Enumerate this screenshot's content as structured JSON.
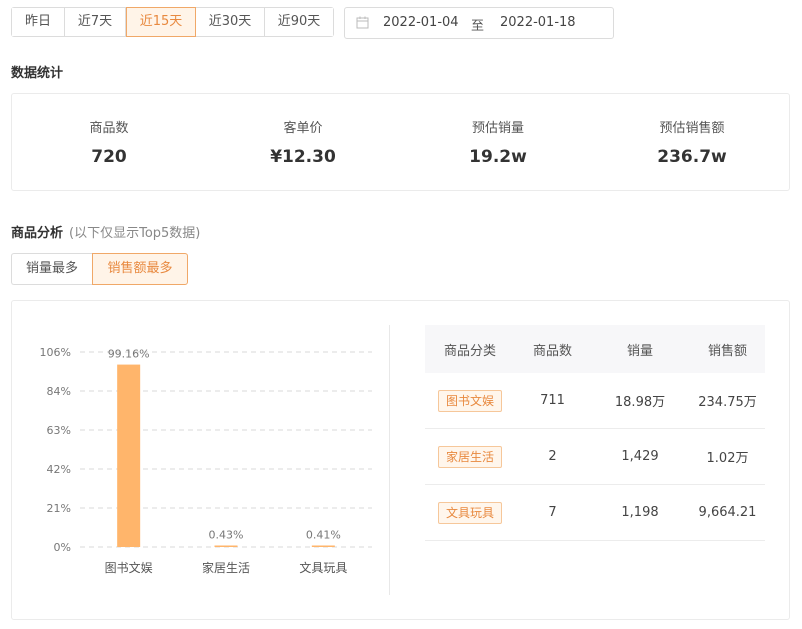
{
  "date_range": {
    "options": [
      {
        "label": "昨日",
        "active": false
      },
      {
        "label": "近7天",
        "active": false
      },
      {
        "label": "近15天",
        "active": true
      },
      {
        "label": "近30天",
        "active": false
      },
      {
        "label": "近90天",
        "active": false
      }
    ],
    "start": "2022-01-04",
    "separator": "至",
    "end": "2022-01-18"
  },
  "stats": {
    "title": "数据统计",
    "items": [
      {
        "label": "商品数",
        "value": "720"
      },
      {
        "label": "客单价",
        "value": "¥12.30"
      },
      {
        "label": "预估销量",
        "value": "19.2w"
      },
      {
        "label": "预估销售额",
        "value": "236.7w"
      }
    ]
  },
  "analysis": {
    "title": "商品分析",
    "subtitle": "(以下仅显示Top5数据)",
    "tabs": [
      {
        "label": "销量最多",
        "active": false
      },
      {
        "label": "销售额最多",
        "active": true
      }
    ],
    "table": {
      "headers": [
        "商品分类",
        "商品数",
        "销量",
        "销售额"
      ],
      "rows": [
        {
          "category": "图书文娱",
          "count": "711",
          "sales": "18.98万",
          "revenue": "234.75万"
        },
        {
          "category": "家居生活",
          "count": "2",
          "sales": "1,429",
          "revenue": "1.02万"
        },
        {
          "category": "文具玩具",
          "count": "7",
          "sales": "1,198",
          "revenue": "9,664.21"
        }
      ]
    }
  },
  "chart_data": {
    "type": "bar",
    "categories": [
      "图书文娱",
      "家居生活",
      "文具玩具"
    ],
    "values": [
      99.16,
      0.43,
      0.41
    ],
    "data_labels": [
      "99.16%",
      "0.43%",
      "0.41%"
    ],
    "y_ticks": [
      "0%",
      "21%",
      "42%",
      "63%",
      "84%",
      "106%"
    ],
    "ylim": [
      0,
      106
    ],
    "grid": true,
    "bar_color": "#ffb56b"
  },
  "colors": {
    "accent": "#e8893f",
    "accent_bg": "#fff4e8"
  }
}
